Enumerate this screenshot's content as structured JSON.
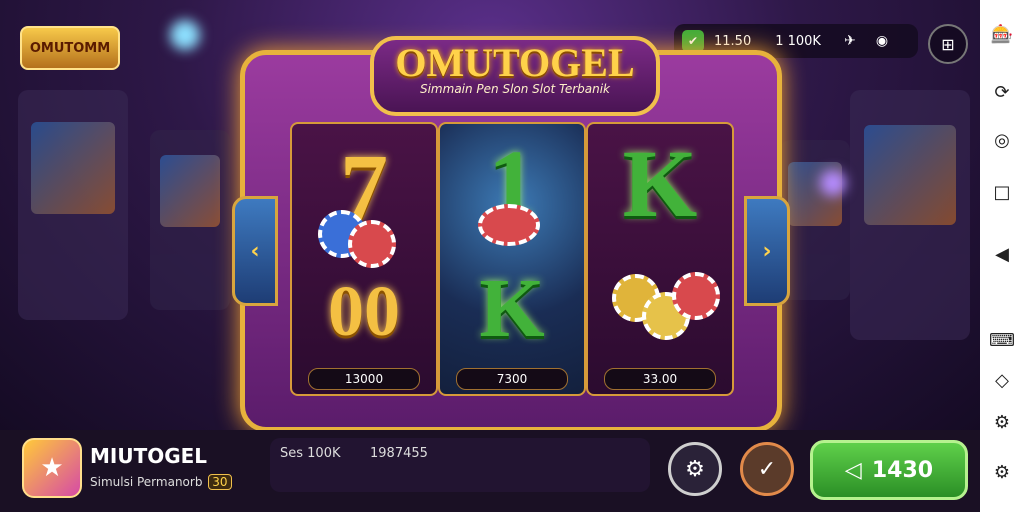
{
  "top_logo": "OMUTOMM",
  "hud": {
    "cash_icon": "cash-icon",
    "balance": "11.50",
    "bet": "1 100K"
  },
  "machine": {
    "title": "OMUTOGEL",
    "subtitle": "Simmain Pen Slon Slot Terbanik"
  },
  "reels": [
    {
      "top_symbol": "7",
      "bottom_symbol": "00",
      "value": "13000"
    },
    {
      "top_symbol": "1",
      "bottom_symbol": "K",
      "value": "7300"
    },
    {
      "top_symbol": "K",
      "bottom_symbol": "",
      "value": "33.00"
    }
  ],
  "arrows": {
    "left": "‹",
    "right": "›"
  },
  "bottom": {
    "app_name": "MIUTOGEL",
    "app_sub": "Simulsi Permanorb",
    "app_sub_badge": "30",
    "stat_a": "Ses 100K",
    "stat_b": "1987455",
    "spin_label": "1430"
  },
  "colors": {
    "accent_gold": "#f4c043",
    "spin_green": "#3fb83a",
    "machine_purple": "#7b2a86"
  }
}
